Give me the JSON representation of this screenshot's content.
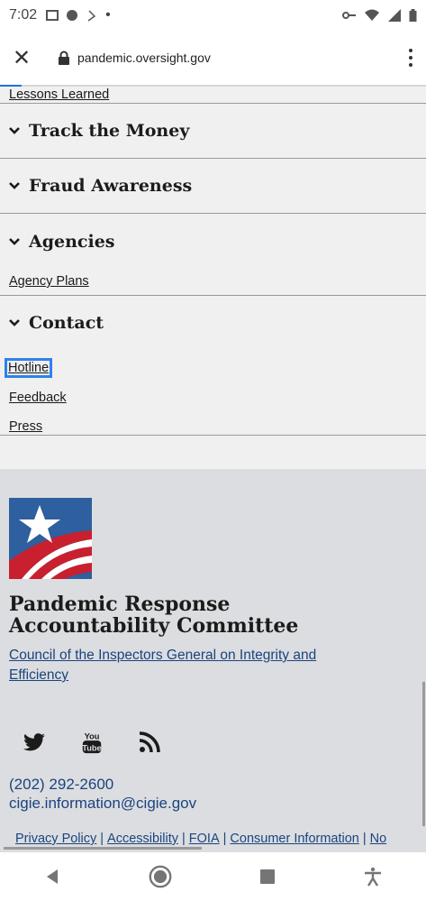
{
  "status_bar": {
    "time": "7:02",
    "dot": "•"
  },
  "browser": {
    "url": "pandemic.oversight.gov"
  },
  "nav": {
    "top_link": "Lessons Learned",
    "sections": [
      {
        "title": "Track the Money"
      },
      {
        "title": "Fraud Awareness"
      },
      {
        "title": "Agencies",
        "links": [
          "Agency Plans"
        ]
      },
      {
        "title": "Contact",
        "links": [
          "Hotline",
          "Feedback",
          "Press"
        ]
      }
    ]
  },
  "footer": {
    "org_name": "Pandemic Response Accountability Committee",
    "council_link": "Council of the Inspectors General on Integrity and Efficiency",
    "phone": "(202) 292-2600",
    "email": "cigie.information@cigie.gov",
    "legal_links": [
      "Privacy Policy",
      "Accessibility",
      "FOIA",
      "Consumer Information",
      "No"
    ],
    "separator": "|",
    "social": [
      "twitter-icon",
      "youtube-icon",
      "rss-icon"
    ]
  },
  "colors": {
    "link": "#1a4480",
    "footer_bg": "#dcdde0",
    "focus": "#2f80ed"
  }
}
